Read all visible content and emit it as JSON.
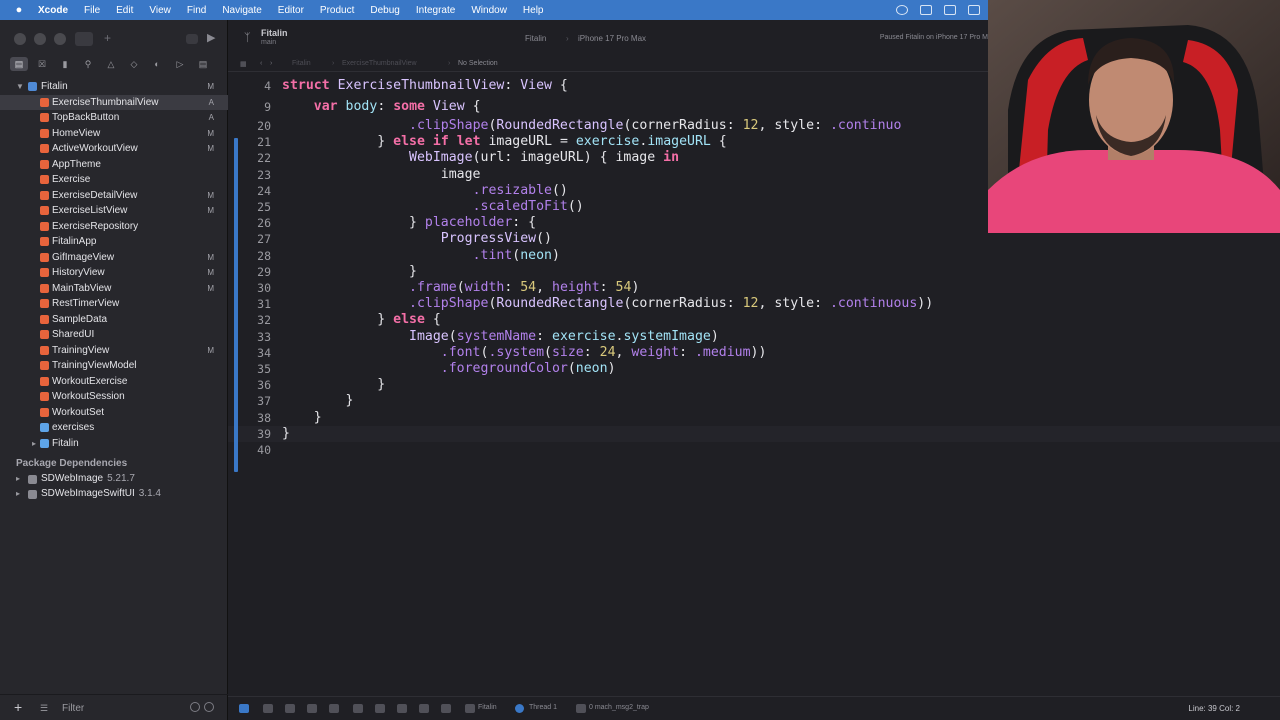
{
  "menubar": {
    "app": "Xcode",
    "items": [
      "File",
      "Edit",
      "View",
      "Find",
      "Navigate",
      "Editor",
      "Product",
      "Debug",
      "Integrate",
      "Window",
      "Help"
    ]
  },
  "toolbar": {
    "scheme_name": "Fitalin",
    "scheme_branch": "main",
    "destination_scheme": "Fitalin",
    "destination_device": "iPhone 17 Pro Max",
    "status": "Paused Fitalin on iPhone 17 Pro M"
  },
  "jumpbar": {
    "crumb_project": "Fitalin",
    "crumb_file": "ExerciseThumbnailView",
    "crumb_selection": "No Selection"
  },
  "navigator": {
    "project": "Fitalin",
    "project_badge": "M",
    "files": [
      {
        "name": "ExerciseThumbnailView",
        "badge": "A",
        "selected": true
      },
      {
        "name": "TopBackButton",
        "badge": "A"
      },
      {
        "name": "HomeView",
        "badge": "M"
      },
      {
        "name": "ActiveWorkoutView",
        "badge": "M"
      },
      {
        "name": "AppTheme",
        "badge": ""
      },
      {
        "name": "Exercise",
        "badge": ""
      },
      {
        "name": "ExerciseDetailView",
        "badge": "M"
      },
      {
        "name": "ExerciseListView",
        "badge": "M"
      },
      {
        "name": "ExerciseRepository",
        "badge": ""
      },
      {
        "name": "FitalinApp",
        "badge": ""
      },
      {
        "name": "GifImageView",
        "badge": "M"
      },
      {
        "name": "HistoryView",
        "badge": "M"
      },
      {
        "name": "MainTabView",
        "badge": "M"
      },
      {
        "name": "RestTimerView",
        "badge": ""
      },
      {
        "name": "SampleData",
        "badge": ""
      },
      {
        "name": "SharedUI",
        "badge": ""
      },
      {
        "name": "TrainingView",
        "badge": "M"
      },
      {
        "name": "TrainingViewModel",
        "badge": ""
      },
      {
        "name": "WorkoutExercise",
        "badge": ""
      },
      {
        "name": "WorkoutSession",
        "badge": ""
      },
      {
        "name": "WorkoutSet",
        "badge": ""
      },
      {
        "name": "exercises",
        "badge": ""
      }
    ],
    "product": "Fitalin",
    "package_header": "Package Dependencies",
    "packages": [
      {
        "name": "SDWebImage",
        "version": "5.21.7"
      },
      {
        "name": "SDWebImageSwiftUI",
        "version": "3.1.4"
      }
    ],
    "filter_placeholder": "Filter"
  },
  "code": {
    "sticky": [
      {
        "n": "4",
        "tokens": [
          [
            "struct",
            "kw"
          ],
          [
            " ",
            "pl"
          ],
          [
            "ExerciseThumbnailView",
            "ty"
          ],
          [
            ": ",
            "pl"
          ],
          [
            "View",
            "ty"
          ],
          [
            " {",
            "pl"
          ]
        ]
      },
      {
        "n": "9",
        "tokens": [
          [
            "    ",
            "pl"
          ],
          [
            "var",
            "kw"
          ],
          [
            " ",
            "pl"
          ],
          [
            "body",
            "id"
          ],
          [
            ": ",
            "pl"
          ],
          [
            "some",
            "kw"
          ],
          [
            " ",
            "pl"
          ],
          [
            "View",
            "ty"
          ],
          [
            " {",
            "pl"
          ]
        ]
      }
    ],
    "lines": [
      {
        "n": "20",
        "tokens": [
          [
            "                ",
            "pl"
          ],
          [
            ".clipShape",
            "fn"
          ],
          [
            "(",
            "pl"
          ],
          [
            "RoundedRectangle",
            "ty"
          ],
          [
            "(",
            "pl"
          ],
          [
            "cornerRadius",
            "pl"
          ],
          [
            ": ",
            "pl"
          ],
          [
            "12",
            "nu"
          ],
          [
            ", ",
            "pl"
          ],
          [
            "style",
            "pl"
          ],
          [
            ": ",
            "pl"
          ],
          [
            ".continuo",
            "pr"
          ]
        ]
      },
      {
        "n": "21",
        "tokens": [
          [
            "            } ",
            "pl"
          ],
          [
            "else",
            "kw"
          ],
          [
            " ",
            "pl"
          ],
          [
            "if",
            "kw"
          ],
          [
            " ",
            "pl"
          ],
          [
            "let",
            "kw"
          ],
          [
            " imageURL = ",
            "pl"
          ],
          [
            "exercise",
            "id"
          ],
          [
            ".",
            "pl"
          ],
          [
            "imageURL",
            "id"
          ],
          [
            " {",
            "pl"
          ]
        ]
      },
      {
        "n": "22",
        "tokens": [
          [
            "                ",
            "pl"
          ],
          [
            "WebImage",
            "ty"
          ],
          [
            "(url: imageURL) { image ",
            "pl"
          ],
          [
            "in",
            "kw"
          ]
        ]
      },
      {
        "n": "23",
        "tokens": [
          [
            "                    image",
            "pl"
          ]
        ]
      },
      {
        "n": "24",
        "tokens": [
          [
            "                        ",
            "pl"
          ],
          [
            ".resizable",
            "fn"
          ],
          [
            "()",
            "pl"
          ]
        ]
      },
      {
        "n": "25",
        "tokens": [
          [
            "                        ",
            "pl"
          ],
          [
            ".scaledToFit",
            "fn"
          ],
          [
            "()",
            "pl"
          ]
        ]
      },
      {
        "n": "26",
        "tokens": [
          [
            "                } ",
            "pl"
          ],
          [
            "placeholder",
            "fn"
          ],
          [
            ": {",
            "pl"
          ]
        ]
      },
      {
        "n": "27",
        "tokens": [
          [
            "                    ",
            "pl"
          ],
          [
            "ProgressView",
            "ty"
          ],
          [
            "()",
            "pl"
          ]
        ]
      },
      {
        "n": "28",
        "tokens": [
          [
            "                        ",
            "pl"
          ],
          [
            ".tint",
            "fn"
          ],
          [
            "(",
            "pl"
          ],
          [
            "neon",
            "id"
          ],
          [
            ")",
            "pl"
          ]
        ]
      },
      {
        "n": "29",
        "tokens": [
          [
            "                }",
            "pl"
          ]
        ]
      },
      {
        "n": "30",
        "tokens": [
          [
            "                ",
            "pl"
          ],
          [
            ".frame",
            "fn"
          ],
          [
            "(",
            "pl"
          ],
          [
            "width",
            "fn"
          ],
          [
            ": ",
            "pl"
          ],
          [
            "54",
            "nu"
          ],
          [
            ", ",
            "pl"
          ],
          [
            "height",
            "fn"
          ],
          [
            ": ",
            "pl"
          ],
          [
            "54",
            "nu"
          ],
          [
            ")",
            "pl"
          ]
        ]
      },
      {
        "n": "31",
        "tokens": [
          [
            "                ",
            "pl"
          ],
          [
            ".clipShape",
            "fn"
          ],
          [
            "(",
            "pl"
          ],
          [
            "RoundedRectangle",
            "ty"
          ],
          [
            "(",
            "pl"
          ],
          [
            "cornerRadius",
            "pl"
          ],
          [
            ": ",
            "pl"
          ],
          [
            "12",
            "nu"
          ],
          [
            ", ",
            "pl"
          ],
          [
            "style",
            "pl"
          ],
          [
            ": ",
            "pl"
          ],
          [
            ".continuous",
            "pr"
          ],
          [
            "))",
            "pl"
          ]
        ]
      },
      {
        "n": "32",
        "tokens": [
          [
            "            } ",
            "pl"
          ],
          [
            "else",
            "kw"
          ],
          [
            " {",
            "pl"
          ]
        ]
      },
      {
        "n": "33",
        "tokens": [
          [
            "                ",
            "pl"
          ],
          [
            "Image",
            "ty"
          ],
          [
            "(",
            "pl"
          ],
          [
            "systemName",
            "fn"
          ],
          [
            ": ",
            "pl"
          ],
          [
            "exercise",
            "id"
          ],
          [
            ".",
            "pl"
          ],
          [
            "systemImage",
            "id"
          ],
          [
            ")",
            "pl"
          ]
        ]
      },
      {
        "n": "34",
        "tokens": [
          [
            "                    ",
            "pl"
          ],
          [
            ".font",
            "fn"
          ],
          [
            "(",
            "pl"
          ],
          [
            ".system",
            "fn"
          ],
          [
            "(",
            "pl"
          ],
          [
            "size",
            "fn"
          ],
          [
            ": ",
            "pl"
          ],
          [
            "24",
            "nu"
          ],
          [
            ", ",
            "pl"
          ],
          [
            "weight",
            "fn"
          ],
          [
            ": ",
            "pl"
          ],
          [
            ".medium",
            "pr"
          ],
          [
            "))",
            "pl"
          ]
        ]
      },
      {
        "n": "35",
        "tokens": [
          [
            "                    ",
            "pl"
          ],
          [
            ".foregroundColor",
            "fn"
          ],
          [
            "(",
            "pl"
          ],
          [
            "neon",
            "id"
          ],
          [
            ")",
            "pl"
          ]
        ]
      },
      {
        "n": "36",
        "tokens": [
          [
            "            }",
            "pl"
          ]
        ]
      },
      {
        "n": "37",
        "tokens": [
          [
            "        }",
            "pl"
          ]
        ]
      },
      {
        "n": "38",
        "tokens": [
          [
            "    }",
            "pl"
          ]
        ]
      },
      {
        "n": "39",
        "tokens": [
          [
            "}",
            "pl"
          ]
        ]
      },
      {
        "n": "40",
        "tokens": []
      }
    ]
  },
  "debugbar": {
    "scheme": "Fitalin",
    "thread": "Thread 1",
    "frame": "0 mach_msg2_trap",
    "line_col": "Line: 39  Col: 2"
  },
  "colors": {
    "menubar": "#3a78c7",
    "sidebar": "#27272c",
    "editor": "#1f1f24",
    "keyword": "#f46fa7",
    "type": "#d9c4ff",
    "function": "#b281eb",
    "number": "#d9c97c",
    "identifier": "#a2e3f6"
  }
}
